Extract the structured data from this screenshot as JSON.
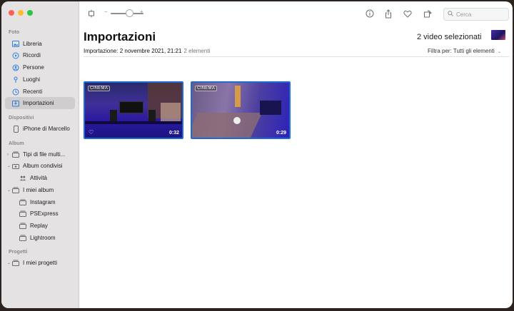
{
  "sidebar": {
    "sections": {
      "foto": "Foto",
      "dispositivi": "Dispositivi",
      "album": "Album",
      "progetti": "Progetti"
    },
    "foto_items": [
      {
        "label": "Libreria",
        "icon": "photo-library-icon"
      },
      {
        "label": "Ricordi",
        "icon": "memories-icon"
      },
      {
        "label": "Persone",
        "icon": "people-icon"
      },
      {
        "label": "Luoghi",
        "icon": "places-icon"
      },
      {
        "label": "Recenti",
        "icon": "recent-icon"
      },
      {
        "label": "Importazioni",
        "icon": "imports-icon",
        "selected": true
      }
    ],
    "device_items": [
      {
        "label": "iPhone di Marcello",
        "icon": "iphone-icon"
      }
    ],
    "album_items": [
      {
        "label": "Tipi di file multi...",
        "icon": "media-types-icon"
      },
      {
        "label": "Album condivisi",
        "icon": "shared-albums-icon"
      },
      {
        "label": "Attività",
        "icon": "activity-icon"
      },
      {
        "label": "I miei album",
        "icon": "my-albums-icon"
      },
      {
        "label": "Instagram",
        "icon": "album-icon"
      },
      {
        "label": "PSExpress",
        "icon": "album-icon"
      },
      {
        "label": "Replay",
        "icon": "album-icon"
      },
      {
        "label": "Lightroom",
        "icon": "album-icon"
      }
    ],
    "project_items": [
      {
        "label": "I miei progetti",
        "icon": "projects-icon"
      }
    ]
  },
  "toolbar": {
    "zoom_minus": "−",
    "zoom_plus": "+",
    "zoom_level": 0.55,
    "search_placeholder": "Cerca"
  },
  "main": {
    "title": "Importazioni",
    "selection_count": "2 video selezionati",
    "import_date": "Importazione: 2 novembre 2021, 21:21",
    "item_count": "2 elementi",
    "filter_label": "Filtra per: Tutti gli elementi",
    "videos": [
      {
        "tag": "CINEMA",
        "duration": "0:32",
        "favorite": true
      },
      {
        "tag": "CINEMA",
        "duration": "0:29",
        "favorite": false
      }
    ]
  },
  "colors": {
    "accent": "#1f6bd6",
    "sidebar_bg": "#e4e2e3",
    "icon_blue": "#2f7de1"
  }
}
